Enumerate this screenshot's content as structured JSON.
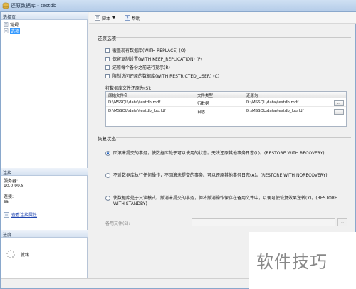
{
  "window": {
    "title": "还原数据库 - testdb"
  },
  "left_panel": {
    "select_page_header": "选择页",
    "pages": [
      {
        "label": "常规",
        "selected": false
      },
      {
        "label": "选项",
        "selected": true
      }
    ],
    "connection_header": "连接",
    "server_label": "服务器:",
    "server_value": "10.0.99.8",
    "connection_label": "连接:",
    "connection_value": "sa",
    "view_props_link": "查看连接属性",
    "progress_header": "进度",
    "progress_status": "就绪"
  },
  "toolbar": {
    "script_label": "脚本",
    "help_label": "帮助"
  },
  "restore_options": {
    "title": "还原选项",
    "checkboxes": [
      {
        "label": "覆盖现有数据库(WITH REPLACE) (O)",
        "checked": false
      },
      {
        "label": "保留复制设置(WITH KEEP_REPLICATION) (P)",
        "checked": false
      },
      {
        "label": "还原每个备份之前进行提示(R)",
        "checked": false
      },
      {
        "label": "限制访问还原的数据库(WITH RESTRICTED_USER) (C)",
        "checked": false
      }
    ],
    "files_label": "将数据库文件还原为(S):",
    "grid": {
      "headers": [
        "原始文件名",
        "文件类型",
        "还原为"
      ],
      "rows": [
        {
          "original": "D:\\MSSQL\\data\\testdb.mdf",
          "type": "行数据",
          "restore_as": "D:\\MSSQL\\data\\testdb.mdf",
          "browse": "..."
        },
        {
          "original": "D:\\MSSQL\\data\\testdb_log.ldf",
          "type": "日志",
          "restore_as": "D:\\MSSQL\\data\\testdb_log.ldf",
          "browse": "..."
        }
      ]
    }
  },
  "recovery_state": {
    "title": "恢复状态",
    "options": [
      {
        "label": "回滚未提交的事务，使数据库处于可以使用的状态。无法还原其他事务日志(L)。(RESTORE WITH RECOVERY)",
        "selected": true
      },
      {
        "label": "不对数据库执行任何操作，不回滚未提交的事务。可以还原其他事务日志(A)。(RESTORE WITH NORECOVERY)",
        "selected": false
      },
      {
        "label": "使数据库处于只读模式。撤消未提交的事务，但将撤消操作保存在备用文件中，以便可使恢复效果逆转(Y)。(RESTORE WITH STANDBY)",
        "selected": false
      }
    ],
    "standby_label": "备用文件(S):",
    "standby_value": "",
    "standby_browse": "..."
  },
  "watermark": {
    "text": "软件技巧"
  },
  "colors": {
    "accent": "#3399ff",
    "radio_dot": "#1d5fbf",
    "link": "#2046b0"
  }
}
